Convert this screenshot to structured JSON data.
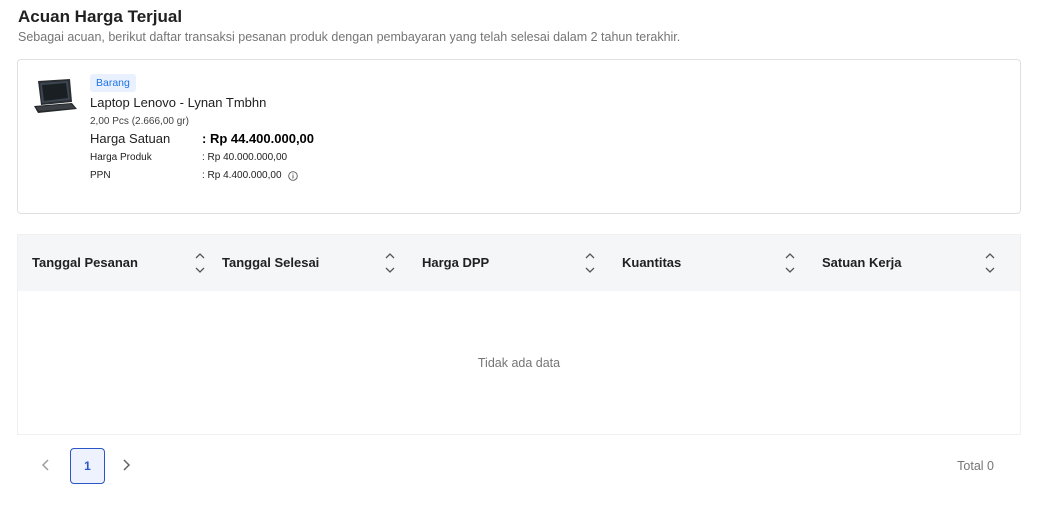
{
  "header": {
    "title": "Acuan Harga Terjual",
    "subtitle": "Sebagai acuan, berikut daftar transaksi pesanan produk dengan pembayaran yang telah selesai dalam 2 tahun terakhir."
  },
  "product": {
    "badge": "Barang",
    "name": "Laptop Lenovo - Lynan Tmbhn",
    "quantity": "2,00 Pcs (2.666,00 gr)",
    "unit_price_label": "Harga Satuan",
    "unit_price_value": ": Rp 44.400.000,00",
    "product_price_label": "Harga Produk",
    "product_price_value": ": Rp 40.000.000,00",
    "tax_label": "PPN",
    "tax_value": ": Rp 4.400.000,00",
    "image_icon": "laptop-image",
    "info_icon": "info-icon"
  },
  "table": {
    "columns": [
      "Tanggal Pesanan",
      "Tanggal Selesai",
      "Harga DPP",
      "Kuantitas",
      "Satuan Kerja"
    ],
    "rows": [],
    "empty_text": "Tidak ada data",
    "sort_icon": "sort-icon"
  },
  "pagination": {
    "current_page": "1",
    "total_text": "Total 0",
    "prev_icon": "chevron-left-icon",
    "next_icon": "chevron-right-icon",
    "active_color": "#2b56c6"
  }
}
